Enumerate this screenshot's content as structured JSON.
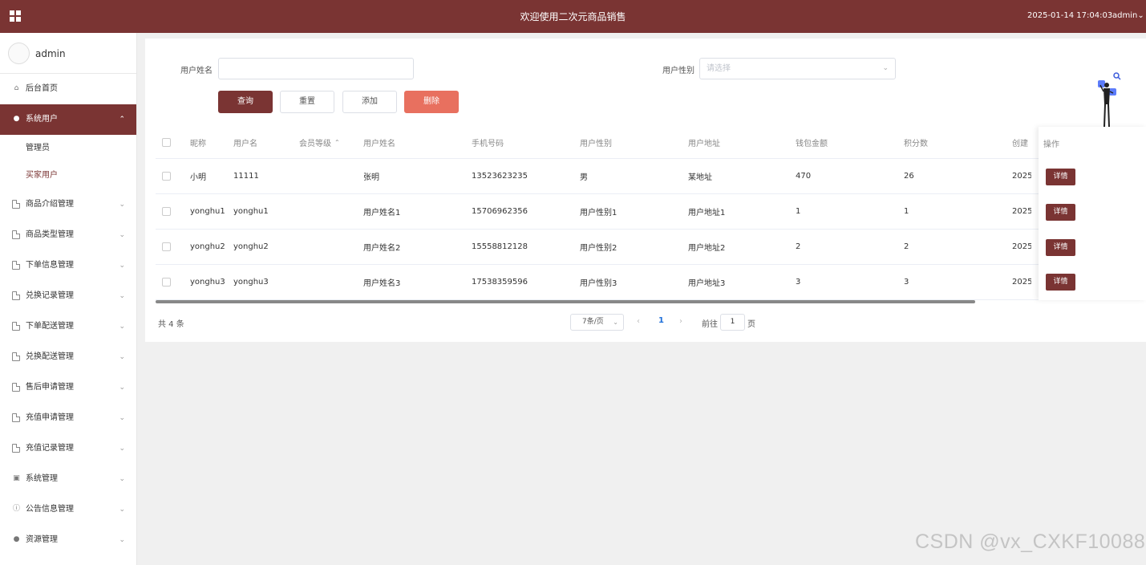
{
  "topbar": {
    "title": "欢迎使用二次元商品销售",
    "datetime": "2025-01-14 17:04:03",
    "user": "admin",
    "user_caret": "⌄"
  },
  "sidebar": {
    "username": "admin",
    "items": [
      {
        "label": "后台首页",
        "icon": "home-icon"
      },
      {
        "label": "系统用户",
        "icon": "user-icon",
        "active": true
      },
      {
        "label": "商品介绍管理",
        "icon": "document-icon"
      },
      {
        "label": "商品类型管理",
        "icon": "document-icon"
      },
      {
        "label": "下单信息管理",
        "icon": "document-icon"
      },
      {
        "label": "兑换记录管理",
        "icon": "document-icon"
      },
      {
        "label": "下单配送管理",
        "icon": "document-icon"
      },
      {
        "label": "兑换配送管理",
        "icon": "document-icon"
      },
      {
        "label": "售后申请管理",
        "icon": "document-icon"
      },
      {
        "label": "充值申请管理",
        "icon": "document-icon"
      },
      {
        "label": "充值记录管理",
        "icon": "document-icon"
      },
      {
        "label": "系统管理",
        "icon": "picture-icon"
      },
      {
        "label": "公告信息管理",
        "icon": "info-icon"
      },
      {
        "label": "资源管理",
        "icon": "bulb-icon"
      }
    ],
    "subitems": [
      {
        "label": "管理员"
      },
      {
        "label": "买家用户",
        "current": true
      }
    ]
  },
  "search": {
    "name_label": "用户姓名",
    "name_value": "",
    "gender_label": "用户性别",
    "gender_placeholder": "请选择"
  },
  "buttons": {
    "query": "查询",
    "reset": "重置",
    "add": "添加",
    "delete": "删除"
  },
  "table": {
    "columns": [
      "昵称",
      "用户名",
      "会员等级",
      "用户姓名",
      "手机号码",
      "用户性别",
      "用户地址",
      "钱包金额",
      "积分数",
      "创建",
      "操作"
    ],
    "sort_glyph": "⌃",
    "rows": [
      {
        "nickname": "小明",
        "username": "11111",
        "level": "",
        "realname": "张明",
        "phone": "13523623235",
        "gender": "男",
        "address": "某地址",
        "wallet": "470",
        "points": "26",
        "created": "2025",
        "action": "详情"
      },
      {
        "nickname": "yonghu1",
        "username": "yonghu1",
        "level": "",
        "realname": "用户姓名1",
        "phone": "15706962356",
        "gender": "用户性别1",
        "address": "用户地址1",
        "wallet": "1",
        "points": "1",
        "created": "2025",
        "action": "详情"
      },
      {
        "nickname": "yonghu2",
        "username": "yonghu2",
        "level": "",
        "realname": "用户姓名2",
        "phone": "15558812128",
        "gender": "用户性别2",
        "address": "用户地址2",
        "wallet": "2",
        "points": "2",
        "created": "2025",
        "action": "详情"
      },
      {
        "nickname": "yonghu3",
        "username": "yonghu3",
        "level": "",
        "realname": "用户姓名3",
        "phone": "17538359596",
        "gender": "用户性别3",
        "address": "用户地址3",
        "wallet": "3",
        "points": "3",
        "created": "2025",
        "action": "详情"
      }
    ]
  },
  "pagination": {
    "total": "共 4 条",
    "page_size": "7条/页",
    "current_page": "1",
    "goto_label": "前往",
    "goto_value": "1",
    "goto_suffix": "页"
  },
  "watermark": "CSDN @vx_CXKF10088",
  "colors": {
    "primary": "#7a3433",
    "danger": "#e8705f",
    "link": "#1e6fd9"
  }
}
